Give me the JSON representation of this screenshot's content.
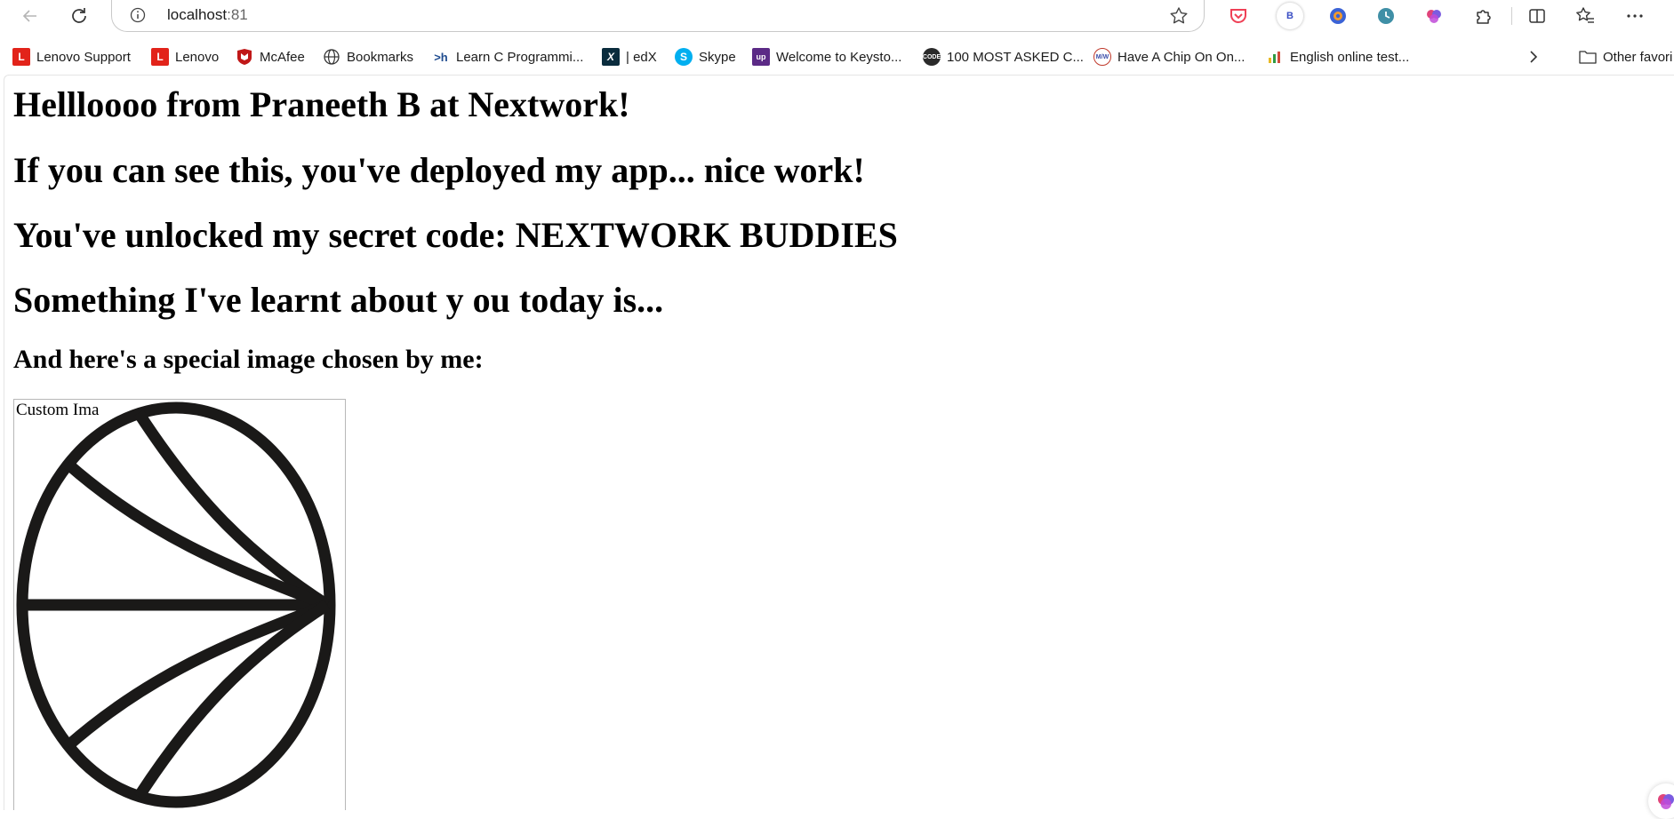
{
  "browser": {
    "url_host": "localhost",
    "url_port": ":81",
    "profile_badge": "B"
  },
  "bookmarks": [
    {
      "label": "Lenovo Support",
      "icon": "lenovo-icon"
    },
    {
      "label": "Lenovo",
      "icon": "lenovo-icon"
    },
    {
      "label": "McAfee",
      "icon": "mcafee-icon"
    },
    {
      "label": "Bookmarks",
      "icon": "globe-icon"
    },
    {
      "label": "Learn C Programmi...",
      "icon": "hackerrank-icon"
    },
    {
      "label": "| edX",
      "icon": "edx-icon"
    },
    {
      "label": "Skype",
      "icon": "skype-icon"
    },
    {
      "label": "Welcome to Keysto...",
      "icon": "keystone-icon"
    },
    {
      "label": "100 MOST ASKED C...",
      "icon": "code-icon"
    },
    {
      "label": "Have A Chip On On...",
      "icon": "mw-icon"
    },
    {
      "label": "English online test...",
      "icon": "chart-icon"
    }
  ],
  "other_favorites": "Other favori",
  "page": {
    "heading_1": "Hellloooo from Praneeth B at Nextwork!",
    "heading_2": "If you can see this, you've deployed my app... nice work!",
    "heading_3": "You've unlocked my secret code: NEXTWORK BUDDIES",
    "heading_4": "Something I've learnt about y ou today is...",
    "subheading": "And here's a special image chosen by me:",
    "image_alt": "Custom Ima"
  },
  "colors": {
    "lenovo_red": "#e2231a",
    "mcafee_red": "#c01818",
    "skype_blue": "#00aff0",
    "keystone_purple": "#5b2a86",
    "pocket_red": "#ef4056"
  }
}
